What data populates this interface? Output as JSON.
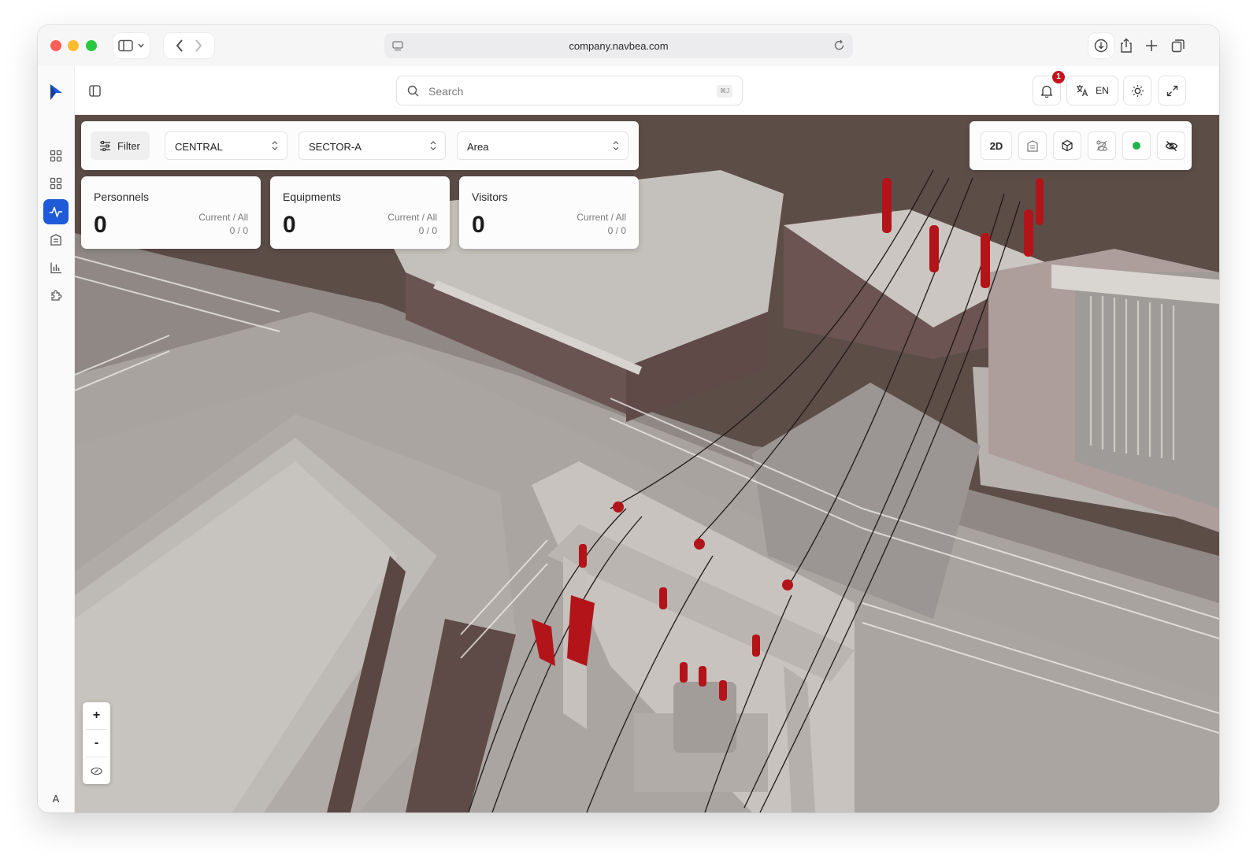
{
  "browser": {
    "url": "company.navbea.com"
  },
  "sidebar": {
    "items": [
      {
        "icon": "dashboard-icon",
        "active": false
      },
      {
        "icon": "grid-icon",
        "active": false
      },
      {
        "icon": "activity-icon",
        "active": true
      },
      {
        "icon": "building-icon",
        "active": false
      },
      {
        "icon": "bar-chart-icon",
        "active": false
      },
      {
        "icon": "puzzle-icon",
        "active": false
      }
    ],
    "avatar_initial": "A"
  },
  "header": {
    "search_placeholder": "Search",
    "search_shortcut": "⌘J",
    "notification_count": "1",
    "language": "EN"
  },
  "filter": {
    "button_label": "Filter",
    "region": "CENTRAL",
    "sector": "SECTOR-A",
    "area": "Area"
  },
  "stats": [
    {
      "title": "Personnels",
      "value": "0",
      "label": "Current / All",
      "ratio": "0 / 0"
    },
    {
      "title": "Equipments",
      "value": "0",
      "label": "Current / All",
      "ratio": "0 / 0"
    },
    {
      "title": "Visitors",
      "value": "0",
      "label": "Current / All",
      "ratio": "0 / 0"
    }
  ],
  "view_controls": {
    "mode_label": "2D",
    "status_color": "#22b14c"
  },
  "zoom": {
    "in_label": "+",
    "out_label": "-"
  },
  "colors": {
    "accent": "#1f5bd8",
    "badge": "#c2161b",
    "insulator": "#b3141a"
  }
}
